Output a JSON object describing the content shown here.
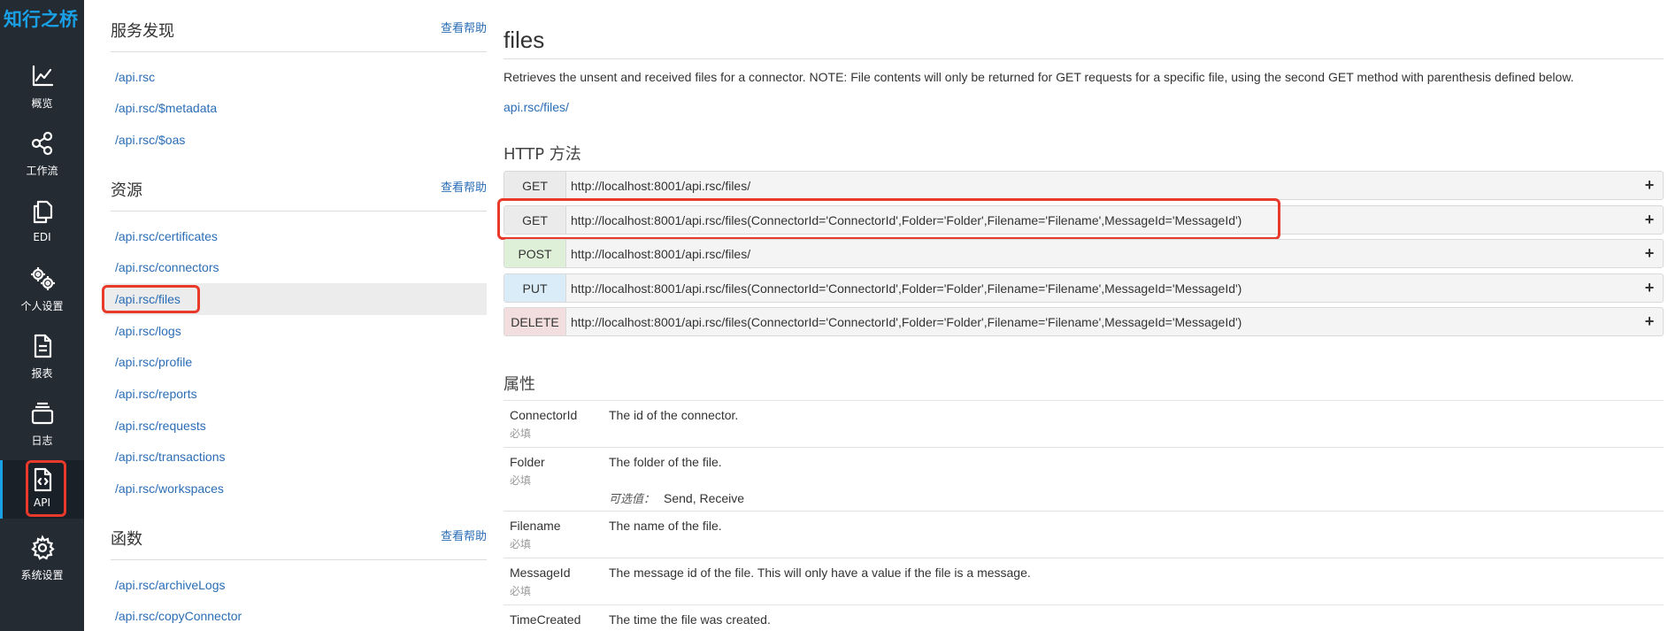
{
  "app": {
    "logo": "知行之桥"
  },
  "nav": {
    "items": [
      {
        "label": "概览",
        "icon": "chart-line-icon"
      },
      {
        "label": "工作流",
        "icon": "share-nodes-icon"
      },
      {
        "label": "EDI",
        "icon": "copy-icon"
      },
      {
        "label": "个人设置",
        "icon": "gears-icon"
      },
      {
        "label": "报表",
        "icon": "document-icon"
      },
      {
        "label": "日志",
        "icon": "stack-icon"
      },
      {
        "label": "API",
        "icon": "code-file-icon",
        "active": true
      },
      {
        "label": "系统设置",
        "icon": "gear-icon"
      }
    ]
  },
  "sidebar": {
    "discovery": {
      "title": "服务发现",
      "help": "查看帮助",
      "links": [
        "/api.rsc",
        "/api.rsc/$metadata",
        "/api.rsc/$oas"
      ]
    },
    "resources": {
      "title": "资源",
      "help": "查看帮助",
      "links": [
        "/api.rsc/certificates",
        "/api.rsc/connectors",
        "/api.rsc/files",
        "/api.rsc/logs",
        "/api.rsc/profile",
        "/api.rsc/reports",
        "/api.rsc/requests",
        "/api.rsc/transactions",
        "/api.rsc/workspaces"
      ],
      "active": "/api.rsc/files"
    },
    "functions": {
      "title": "函数",
      "help": "查看帮助",
      "links": [
        "/api.rsc/archiveLogs",
        "/api.rsc/copyConnector"
      ]
    }
  },
  "main": {
    "title": "files",
    "description": "Retrieves the unsent and received files for a connector. NOTE: File contents will only be returned for GET requests for a specific file, using the second GET method with parenthesis defined below.",
    "base_link": "api.rsc/files/",
    "methods_heading": "HTTP 方法",
    "methods": [
      {
        "verb": "GET",
        "url": "http://localhost:8001/api.rsc/files/",
        "expand": "+"
      },
      {
        "verb": "GET",
        "url": "http://localhost:8001/api.rsc/files(ConnectorId='ConnectorId',Folder='Folder',Filename='Filename',MessageId='MessageId')",
        "expand": "+"
      },
      {
        "verb": "POST",
        "url": "http://localhost:8001/api.rsc/files/",
        "expand": "+"
      },
      {
        "verb": "PUT",
        "url": "http://localhost:8001/api.rsc/files(ConnectorId='ConnectorId',Folder='Folder',Filename='Filename',MessageId='MessageId')",
        "expand": "+"
      },
      {
        "verb": "DELETE",
        "url": "http://localhost:8001/api.rsc/files(ConnectorId='ConnectorId',Folder='Folder',Filename='Filename',MessageId='MessageId')",
        "expand": "+"
      }
    ],
    "properties_heading": "属性",
    "properties": [
      {
        "name": "ConnectorId",
        "required": "必填",
        "description": "The id of the connector."
      },
      {
        "name": "Folder",
        "required": "必填",
        "description": "The folder of the file.",
        "options_label": "可选值：",
        "options": "Send, Receive"
      },
      {
        "name": "Filename",
        "required": "必填",
        "description": "The name of the file."
      },
      {
        "name": "MessageId",
        "required": "必填",
        "description": "The message id of the file. This will only have a value if the file is a message."
      },
      {
        "name": "TimeCreated",
        "required": "",
        "description": "The time the file was created."
      }
    ]
  },
  "colors": {
    "nav_bg": "#242b33",
    "accent": "#1aa0e6",
    "link": "#2a6db6",
    "highlight": "#e8392b",
    "verb_post": "#dff0d8",
    "verb_put": "#d9ecf7",
    "verb_delete": "#f2dede"
  }
}
